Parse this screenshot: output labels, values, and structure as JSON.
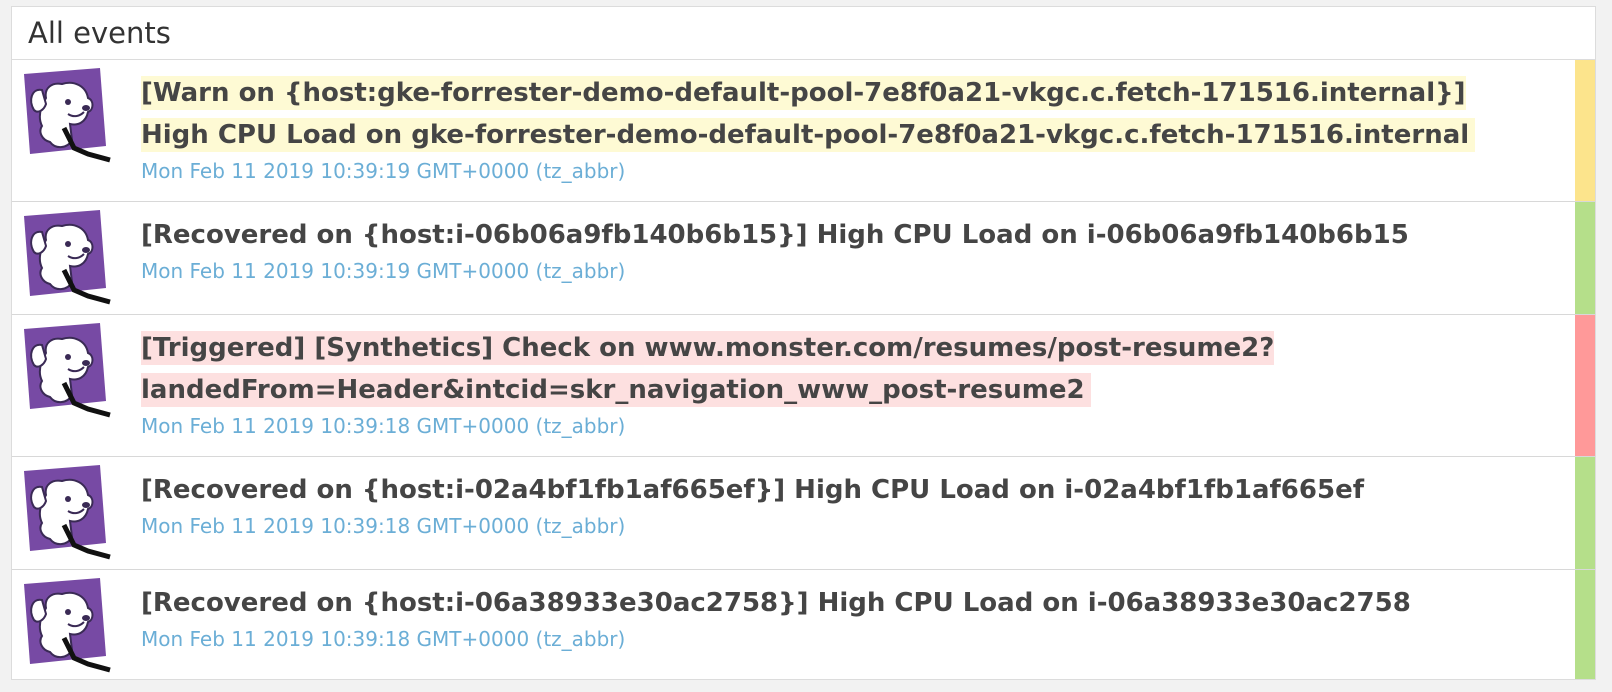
{
  "widget": {
    "title": "All events"
  },
  "colors": {
    "warn_bar": "#fce48c",
    "warn_bg": "#fefad4",
    "ok_bar": "#b5df8a",
    "error_bar": "#ff9999",
    "error_bg": "#fde0e0",
    "timestamp": "#6baed6"
  },
  "events": [
    {
      "status": "warn",
      "avatar_icon": "datadog-dog-icon",
      "title": "[Warn on {host:gke-forrester-demo-default-pool-7e8f0a21-vkgc.c.fetch-171516.internal}] High CPU Load on gke-forrester-demo-default-pool-7e8f0a21-vkgc.c.fetch-171516.internal",
      "time": "Mon Feb 11 2019 10:39:19 GMT+0000 (tz_abbr)"
    },
    {
      "status": "ok",
      "avatar_icon": "datadog-dog-icon",
      "title": "[Recovered on {host:i-06b06a9fb140b6b15}] High CPU Load on i-06b06a9fb140b6b15",
      "time": "Mon Feb 11 2019 10:39:19 GMT+0000 (tz_abbr)"
    },
    {
      "status": "error",
      "avatar_icon": "datadog-dog-icon",
      "title": "[Triggered] [Synthetics] Check on www.monster.com/resumes/post-resume2?landedFrom=Header&intcid=skr_navigation_www_post-resume2",
      "time": "Mon Feb 11 2019 10:39:18 GMT+0000 (tz_abbr)"
    },
    {
      "status": "ok",
      "avatar_icon": "datadog-dog-icon",
      "title": "[Recovered on {host:i-02a4bf1fb1af665ef}] High CPU Load on i-02a4bf1fb1af665ef",
      "time": "Mon Feb 11 2019 10:39:18 GMT+0000 (tz_abbr)"
    },
    {
      "status": "ok",
      "avatar_icon": "datadog-dog-icon",
      "title": "[Recovered on {host:i-06a38933e30ac2758}] High CPU Load on i-06a38933e30ac2758",
      "time": "Mon Feb 11 2019 10:39:18 GMT+0000 (tz_abbr)"
    }
  ]
}
